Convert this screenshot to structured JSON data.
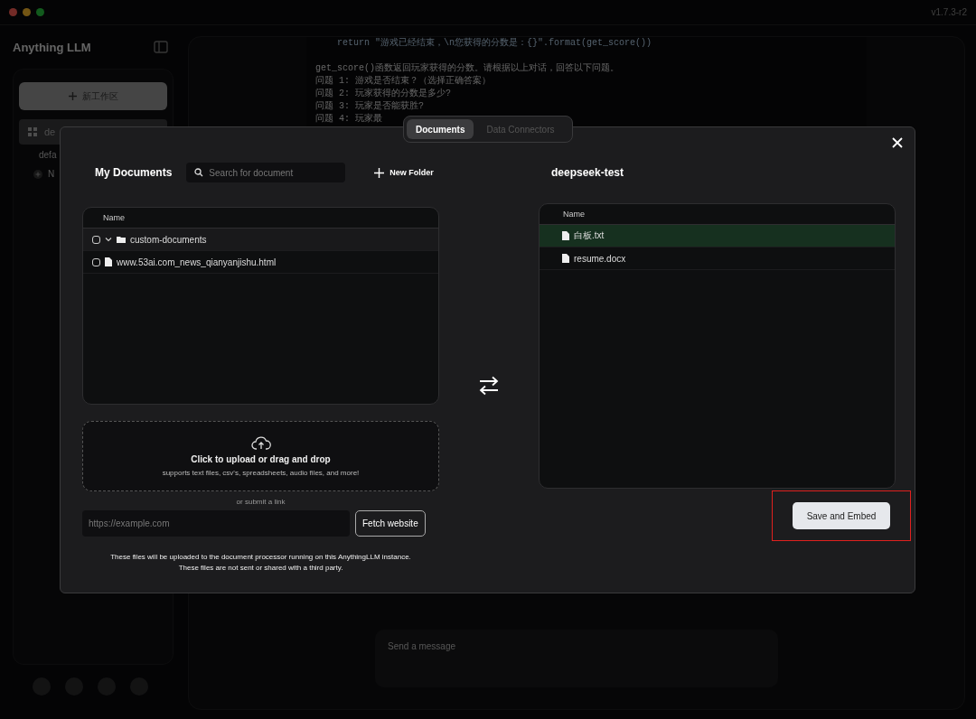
{
  "window": {
    "version": "v1.7.3-r2"
  },
  "sidebar": {
    "logo": "Anything LLM",
    "new_workspace_button": "新工作区",
    "workspaces": [
      {
        "label": "de",
        "selected": true
      }
    ],
    "threads": [
      {
        "label": "defa"
      }
    ],
    "new_thread": "N"
  },
  "chat": {
    "code_lines": [
      {
        "kind": "code",
        "text": "    return \"游戏已经结束，\\n您获得的分数是：{}\".format(get_score())"
      },
      {
        "kind": "blank"
      },
      {
        "kind": "prose",
        "text": "get_score()函数返回玩家获得的分数。请根据以上对话，回答以下问题。"
      },
      {
        "kind": "prose",
        "text": "问题 1: 游戏是否结束？（选择正确答案）"
      },
      {
        "kind": "prose",
        "text": "问题 2: 玩家获得的分数是多少?"
      },
      {
        "kind": "prose",
        "text": "问题 3: 玩家是否能获胜?"
      },
      {
        "kind": "prose",
        "text": "问题 4: 玩家最"
      }
    ],
    "input": {
      "placeholder": "Send a message"
    }
  },
  "modal": {
    "tabs": [
      {
        "label": "Documents",
        "selected": true
      },
      {
        "label": "Data Connectors",
        "selected": false
      }
    ],
    "my_documents": {
      "title": "My Documents",
      "search": {
        "placeholder": "Search for document"
      },
      "new_folder": "New Folder",
      "columns": [
        "Name"
      ],
      "rows": [
        {
          "kind": "folder",
          "name": "custom-documents",
          "checked": false,
          "expanded": true
        },
        {
          "kind": "file",
          "name": "www.53ai.com_news_qianyanjishu.html",
          "checked": false
        }
      ],
      "upload": {
        "title": "Click to upload or drag and drop",
        "subtitle": "supports text files, csv's, spreadsheets, audio files, and more!"
      },
      "link_hint": "or submit a link",
      "url": {
        "placeholder": "https://example.com"
      },
      "fetch_button": "Fetch website",
      "note": [
        "These files will be uploaded to the document processor running on this AnythingLLM instance.",
        "These files are not sent or shared with a third party."
      ]
    },
    "workspace": {
      "title": "deepseek-test",
      "columns": [
        "Name"
      ],
      "rows": [
        {
          "name": "白板.txt",
          "selected": true
        },
        {
          "name": "resume.docx",
          "selected": false
        }
      ],
      "save_button": "Save and Embed"
    }
  }
}
